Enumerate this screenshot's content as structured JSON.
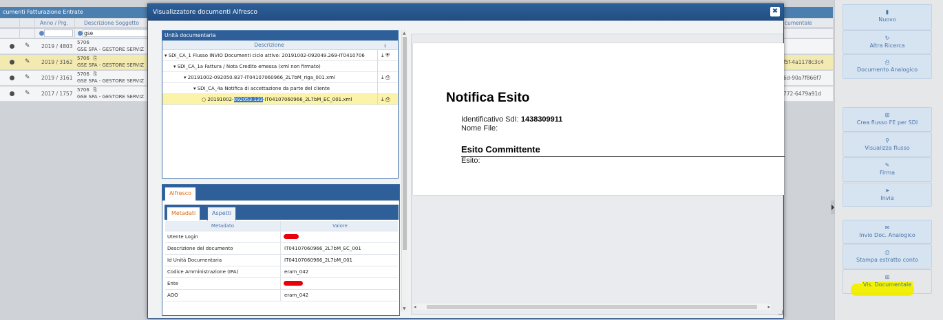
{
  "background": {
    "title": "cumenti Fatturazione Entrate",
    "headers": {
      "anno": "Anno / Prg.",
      "descrizione": "Descrizione Soggetto",
      "right": "cumentale"
    },
    "filter_value": "gse",
    "rows": [
      {
        "anno": "2019 / 4803",
        "code": "5706",
        "name": "GSE SPA - GESTORE SERVIZ",
        "hash": "",
        "selected": false
      },
      {
        "anno": "2019 / 3162",
        "code": "5706  ⎘",
        "name": "GSE SPA - GESTORE SERVIZ",
        "hash": "f5f-4a1178c3c4",
        "selected": true
      },
      {
        "anno": "2019 / 3161",
        "code": "5706  ⎘",
        "name": "GSE SPA - GESTORE SERVIZ",
        "hash": "6d-90a7f866f7",
        "selected": false
      },
      {
        "anno": "2017 / 1757",
        "code": "5706  ⎘",
        "name": "GSE SPA - GESTORE SERVIZ",
        "hash": "772-6479a91d",
        "selected": false
      }
    ]
  },
  "sidebar": {
    "buttons": [
      {
        "label": "Nuovo",
        "icon": "new-file-icon",
        "glyph": "▮"
      },
      {
        "label": "Altra Ricerca",
        "icon": "rotate-icon",
        "glyph": "↻"
      },
      {
        "label": "Documento Analogico",
        "icon": "print-icon",
        "glyph": "⎙"
      },
      {
        "label": "Crea flusso FE per SDI",
        "icon": "grid-icon",
        "glyph": "⊞"
      },
      {
        "label": "Visualizza flusso",
        "icon": "search-icon",
        "glyph": "⚲"
      },
      {
        "label": "Firma",
        "icon": "pen-icon",
        "glyph": "✎"
      },
      {
        "label": "Invia",
        "icon": "send-icon",
        "glyph": "➤"
      },
      {
        "label": "Invio Doc. Analogico",
        "icon": "envelope-icon",
        "glyph": "✉"
      },
      {
        "label": "Stampa estratto conto",
        "icon": "print-icon",
        "glyph": "⎙"
      },
      {
        "label": "Vis. Documentale",
        "icon": "grid-icon",
        "glyph": "⊞"
      }
    ]
  },
  "modal": {
    "title": "Visualizzatore documenti Alfresco",
    "close": "✖",
    "tree": {
      "title": "Unità documentaria",
      "header": "Descrizione",
      "rows": [
        {
          "text": "▾ SDI_CA_1  Flusso INVIO  Documenti ciclo attivo: 20191002-092049.269-IT0410706",
          "actions": "⤓ ⛨"
        },
        {
          "text": "▾ SDI_CA_1a  Fattura / Nota Credito emessa (xml non firmato)",
          "actions": ""
        },
        {
          "text": "▾ 20191002-092050.837-IT04107060966_2L7bM_riga_001.xml",
          "actions": "⤓ ⎙"
        },
        {
          "text": "▾ SDI_CA_4a  Notifica di accettazione da parte del cliente",
          "actions": ""
        },
        {
          "pre": "○ 20191002-",
          "hl": "092053.133",
          "post": "-IT04107060966_2L7bM_EC_001.xml",
          "actions": "⤓ ⎙"
        }
      ]
    },
    "alfresco": {
      "tab": "Alfresco",
      "subtabs": {
        "metadati": "Metadati",
        "aspetti": "Aspetti"
      },
      "headers": {
        "metadato": "Metadato",
        "valore": "Valore"
      },
      "rows": [
        {
          "key": "Utente Login",
          "value": ""
        },
        {
          "key": "Descrizione del documento",
          "value": "IT04107060966_2L7bM_EC_001"
        },
        {
          "key": "Id Unità Documentaria",
          "value": "IT04107060966_2L7bM_001"
        },
        {
          "key": "Codice Amministrazione (IPA)",
          "value": "eram_042"
        },
        {
          "key": "Ente",
          "value": ""
        },
        {
          "key": "AOO",
          "value": "eram_042"
        }
      ]
    },
    "document": {
      "title": "Notifica Esito",
      "id_label": "Identificativo SdI:",
      "id_value": "1438309911",
      "file_label": "Nome File:",
      "section": "Esito Committente",
      "esito_label": "Esito:"
    }
  }
}
